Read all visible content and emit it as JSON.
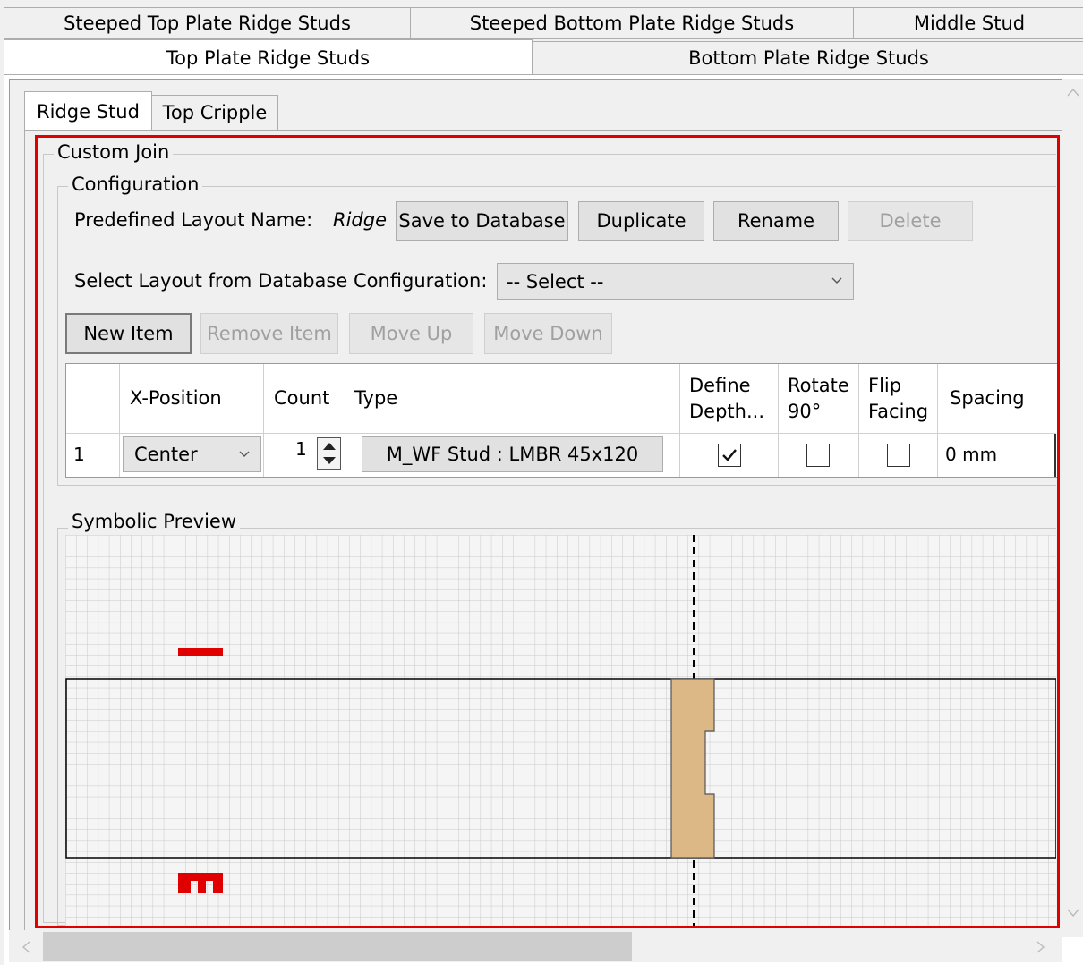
{
  "tabs_row1": [
    "Steeped Top Plate Ridge Studs",
    "Steeped Bottom Plate Ridge Studs",
    "Middle Stud"
  ],
  "tabs_row2": [
    "Top Plate Ridge Studs",
    "Bottom Plate Ridge Studs"
  ],
  "subtabs": [
    "Ridge Stud",
    "Top Cripple"
  ],
  "custom_join": {
    "legend": "Custom Join",
    "configuration": {
      "legend": "Configuration",
      "predefined_label": "Predefined Layout Name:",
      "predefined_value": "Ridge",
      "buttons": {
        "save": "Save to Database",
        "duplicate": "Duplicate",
        "rename": "Rename",
        "delete": "Delete"
      },
      "select_label": "Select Layout from Database Configuration:",
      "select_value": "-- Select --",
      "item_buttons": {
        "new": "New Item",
        "remove": "Remove Item",
        "up": "Move Up",
        "down": "Move Down"
      },
      "table": {
        "headers": {
          "xpos": "X-Position",
          "count": "Count",
          "type": "Type",
          "define": "Define\nDepth...",
          "rotate": "Rotate\n90°",
          "flip": "Flip\nFacing",
          "spacing": "Spacing"
        },
        "rows": [
          {
            "index": "1",
            "xpos": "Center",
            "count": "1",
            "type": "M_WF Stud : LMBR 45x120",
            "define": true,
            "rotate": false,
            "flip": false,
            "spacing": "0 mm"
          }
        ]
      }
    },
    "preview": {
      "legend": "Symbolic Preview"
    }
  },
  "colors": {
    "highlight_border": "#e00000",
    "stud_fill": "#dcb887",
    "grid_line": "#c8c8c8"
  }
}
